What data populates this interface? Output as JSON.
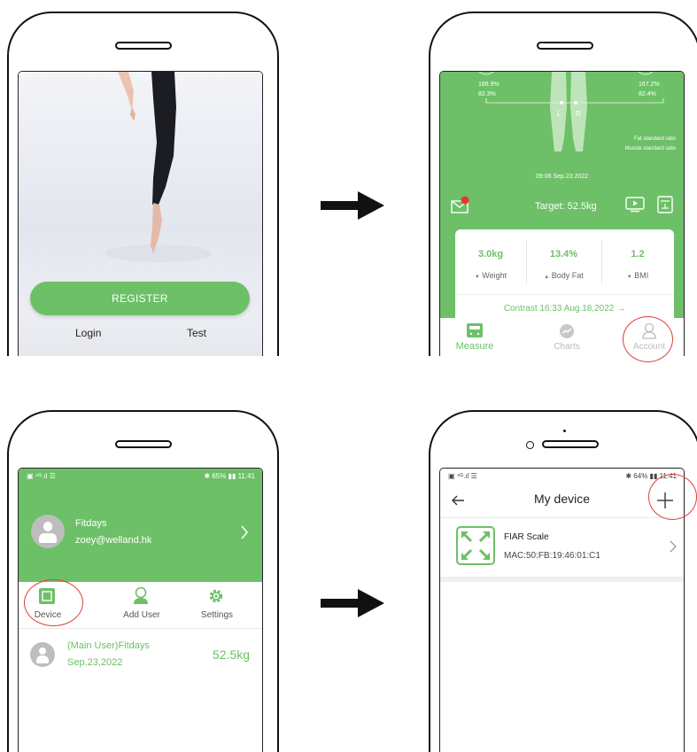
{
  "screens": {
    "register": {
      "register_label": "REGISTER",
      "login_label": "Login",
      "test_label": "Test"
    },
    "measure": {
      "left_pct_top": "166.9%",
      "left_pct_bottom": "82.3%",
      "right_pct_top": "167.2%",
      "right_pct_bottom": "82.4%",
      "leg_left": "L",
      "leg_right": "R",
      "fat_ratio_label": "Fat standard ratio",
      "muscle_ratio_label": "Muscle standard ratio",
      "timestamp": "09:06 Sep.23.2022",
      "target": "Target: 52.5kg",
      "stats": [
        {
          "value": "3.0kg",
          "label": "Weight",
          "trend": "down"
        },
        {
          "value": "13.4%",
          "label": "Body Fat",
          "trend": "up"
        },
        {
          "value": "1.2",
          "label": "BMI",
          "trend": "down"
        }
      ],
      "contrast": "Contrast 16:33 Aug.18,2022 →",
      "tabs": {
        "measure": "Measure",
        "charts": "Charts",
        "account": "Account"
      }
    },
    "account": {
      "status_left": "▣ ⁴ᴳ.ıl ☰",
      "status_right": "✱ 65% ▮▮ 11:41",
      "user_name": "Fitdays",
      "user_email": "zoey@welland.hk",
      "menu": {
        "device": "Device",
        "add_user": "Add User",
        "settings": "Settings"
      },
      "record_name": "(Main User)Fitdays",
      "record_date": "Sep.23,2022",
      "record_weight": "52.5kg"
    },
    "device": {
      "status_left": "▣ ⁴ᴳ.ıl ☰",
      "status_right": "✱ 64% ▮▮ 11:41",
      "title": "My device",
      "device_name": "FIAR Scale",
      "device_mac": "MAC:50:FB:19:46:01:C1"
    }
  },
  "colors": {
    "brand_green": "#6dc067",
    "highlight_red": "#d9413b",
    "notify_red": "#e53935"
  }
}
